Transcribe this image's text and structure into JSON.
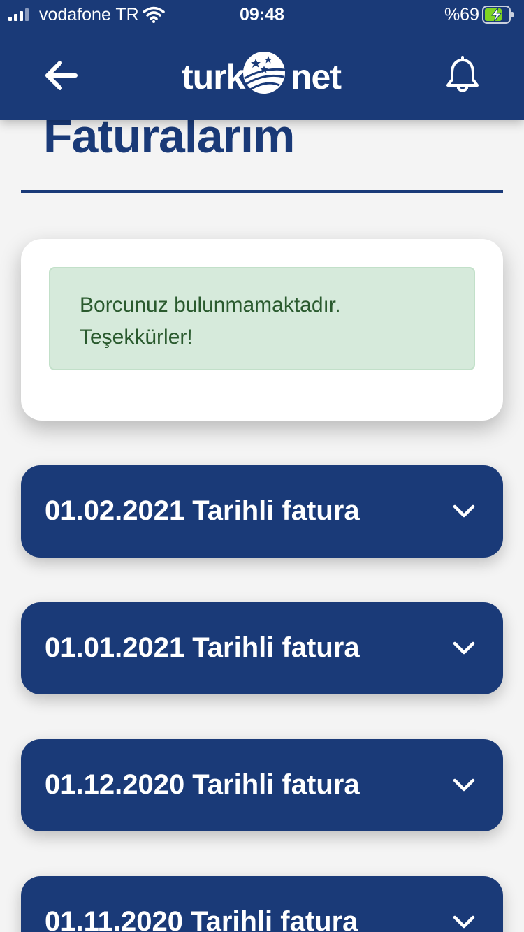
{
  "status_bar": {
    "carrier": "vodafone TR",
    "time": "09:48",
    "battery_percent": "%69"
  },
  "header": {
    "logo_left": "turk",
    "logo_right": "net",
    "brand_color": "#1a3a78"
  },
  "page": {
    "title": "Faturalarım"
  },
  "debt_notice": {
    "line1": "Borcunuz bulunmamaktadır.",
    "line2": "Teşekkürler!",
    "bg_color": "#d6eadb",
    "text_color": "#2a5a2e"
  },
  "invoices": [
    {
      "label": "01.02.2021 Tarihli fatura"
    },
    {
      "label": "01.01.2021 Tarihli fatura"
    },
    {
      "label": "01.12.2020 Tarihli fatura"
    },
    {
      "label": "01.11.2020 Tarihli fatura"
    }
  ],
  "icons": {
    "back": "arrow-left-icon",
    "notifications": "bell-icon",
    "expand": "chevron-down-icon"
  }
}
